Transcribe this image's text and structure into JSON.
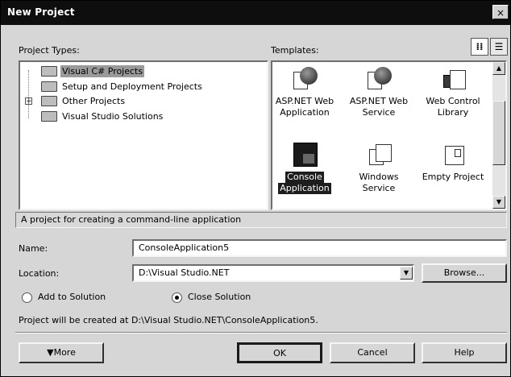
{
  "window": {
    "title": "New Project",
    "close_glyph": "×"
  },
  "project_types": {
    "label": "Project Types:",
    "items": [
      {
        "label": "Visual C# Projects",
        "selected": true,
        "expander": ""
      },
      {
        "label": "Setup and Deployment Projects",
        "selected": false,
        "expander": ""
      },
      {
        "label": "Other Projects",
        "selected": false,
        "expander": "+"
      },
      {
        "label": "Visual Studio Solutions",
        "selected": false,
        "expander": ""
      }
    ]
  },
  "templates": {
    "label": "Templates:",
    "items": [
      {
        "label_line1": "ASP.NET Web",
        "label_line2": "Application",
        "icon": "globe-document-icon"
      },
      {
        "label_line1": "ASP.NET Web",
        "label_line2": "Service",
        "icon": "globe-gear-icon"
      },
      {
        "label_line1": "Web Control",
        "label_line2": "Library",
        "icon": "web-control-icon"
      },
      {
        "label_line1": "Console",
        "label_line2": "Application",
        "icon": "console-icon",
        "selected": true
      },
      {
        "label_line1": "Windows",
        "label_line2": "Service",
        "icon": "windows-service-icon"
      },
      {
        "label_line1": "Empty Project",
        "label_line2": "",
        "icon": "empty-project-icon"
      }
    ],
    "view_large_glyph": "⁞⁞",
    "view_list_glyph": "☰"
  },
  "description": "A project for creating a command-line application",
  "name": {
    "label": "Name:",
    "value": "ConsoleApplication5"
  },
  "location": {
    "label": "Location:",
    "value": "D:\\Visual Studio.NET",
    "browse_label": "Browse..."
  },
  "solution_options": {
    "add_label": "Add to Solution",
    "close_label": "Close Solution",
    "selected": "close"
  },
  "created_at_text": "Project will be created at D:\\Visual Studio.NET\\ConsoleApplication5.",
  "buttons": {
    "more": "▼More",
    "ok": "OK",
    "cancel": "Cancel",
    "help": "Help"
  },
  "colors": {
    "titlebar": "#0e0e0e",
    "dialog_bg": "#d6d6d6",
    "selection": "#1e1e1e"
  }
}
